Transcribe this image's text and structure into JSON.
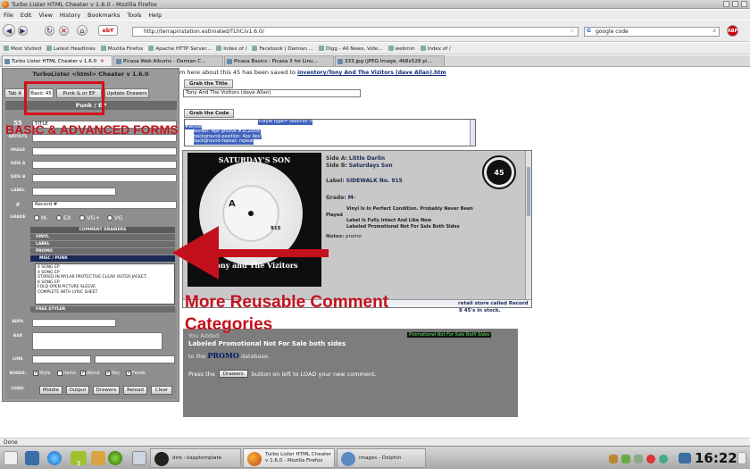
{
  "window": {
    "title": "Turbo Lister HTML Cheater v 1.6.0 - Mozilla Firefox"
  },
  "menu": [
    "File",
    "Edit",
    "View",
    "History",
    "Bookmarks",
    "Tools",
    "Help"
  ],
  "nav": {
    "url": "http://terrapinstation.estimated/TLhC/v1.6.0/",
    "search": "google code",
    "search_engine": "Google"
  },
  "bookmarks": [
    "Most Visited",
    "Latest Headlines",
    "Mozilla Firefox",
    "Apache HTTP Server...",
    "Index of /",
    "Facebook | Damian ...",
    "Digg - All News, Vide...",
    "webmin",
    "Index of /"
  ],
  "tabs": [
    {
      "label": "Turbo Lister HTML Cheater v 1.6.0",
      "active": true
    },
    {
      "label": "Picasa Web Albums - Damian C...",
      "active": false
    },
    {
      "label": "Picasa Basics : Picasa 3 for Linu...",
      "active": false
    },
    {
      "label": "333.jpg (JPEG Image, 468x528 pi...",
      "active": false
    }
  ],
  "sidebar": {
    "app_title": "TurboLister <html> Cheater v 1.6.0",
    "tabs": [
      "Tab 4",
      "Basic 45",
      "Punk & or EP",
      "Update Drawers"
    ],
    "section_title": "Punk / EP",
    "count": "55",
    "fields": [
      {
        "label": "TITLE",
        "value": "TITLE"
      },
      {
        "label": "ARTISTS",
        "value": ""
      },
      {
        "label": "IMAGE",
        "value": ""
      },
      {
        "label": "SIDE A",
        "value": ""
      },
      {
        "label": "SIDE B",
        "value": ""
      },
      {
        "label": "LABEL",
        "value": ""
      },
      {
        "label": "#",
        "value": "Record #"
      }
    ],
    "grade_label": "GRADE",
    "grades": [
      "M-",
      "EX",
      "VG+",
      "VG"
    ],
    "drawers_title": "COMMENT DRAWERS",
    "drawers": [
      "VINYL",
      "LABEL",
      "PROMO",
      "MISC / PUNK"
    ],
    "comment_list": [
      "6 SONG EP",
      "4 SONG EP",
      "STORED IN MYLAR PROTECTIVE CLEAR OUTER JACKET.",
      "6 SONG EP",
      "FOLD OPEN PICTURE SLEEVE",
      "COMPLETE WITH LYRIC SHEET"
    ],
    "free_styler": "FREE STYLER",
    "addl_label": "ADDL",
    "bar_label": "BAR",
    "link_label": "LINK",
    "boxes_label": "BOXES:",
    "boxes": [
      "Style",
      "Items",
      "About",
      "Key",
      "Feeds"
    ],
    "load_label": "LOAD:",
    "load_buttons": [
      "Middle",
      "Output",
      "Drawers",
      "Reload",
      "Clear"
    ]
  },
  "main": {
    "info_prefix": "m here about this 45 has been saved to",
    "info_link": "inventory/Tony And The Vizitors (dave Allan).htm",
    "grab_title_btn": "Grab the Title",
    "title_value": "Tony And The Vizitors (dave Allan)",
    "grab_code_btn": "Grab the Code",
    "code_lines": [
      "<style type=\"text/css\">",
      "#whole",
      "border: 4px groove #1C2059;",
      "background-position: 4px 4px;",
      "background-repeat: repeat"
    ],
    "preview": {
      "sleeve_top": "SATURDAY'S SON",
      "sleeve_bottom": "Tony and The Vizitors",
      "label_letter": "A",
      "label_number": "915",
      "side_a_label": "Side A:",
      "side_a": "Little Darlin",
      "side_b_label": "Side B:",
      "side_b": "Saturdays Son",
      "label_label": "Label:",
      "label_value": "SIDEWALK No. 915",
      "grade_label": "Grade:",
      "grade_value": "M-",
      "played_label": "Played",
      "comments": [
        "Vinyl Is In Perfect Condition. Probably Never Been",
        "Label Is Fully Intact And Like New",
        "Labeled Promotional Not For Sale Both Sides"
      ],
      "notes_label": "Notes:",
      "notes_value": "promo",
      "badge": "45"
    },
    "hidden_text_1": "retail store called Record",
    "hidden_text_2": "8 45's in stock."
  },
  "alert": {
    "you_added": "You Added:",
    "comment": "Labeled Promotional Not For Sale both sides",
    "to_the": "to the",
    "db": "PROMO",
    "database": "database.",
    "press": "Press the",
    "drawers_btn": "Drawers",
    "after": "button on left to LOAD your new comment.",
    "tag": "Promotional Not For Sale Both Sides"
  },
  "annotations": {
    "basic": "BASIC & ADVANCED FORMS",
    "more": "More Reusable Comment",
    "categories": "Categories"
  },
  "status": "Done",
  "taskbar": {
    "pager": "3",
    "terminal": "dire : kapptemplate",
    "firefox": "Turbo Lister HTML Cheater v 1.6.0 - Mozilla Firefox",
    "dolphin": "images - Dolphin",
    "clock": "16:22"
  }
}
